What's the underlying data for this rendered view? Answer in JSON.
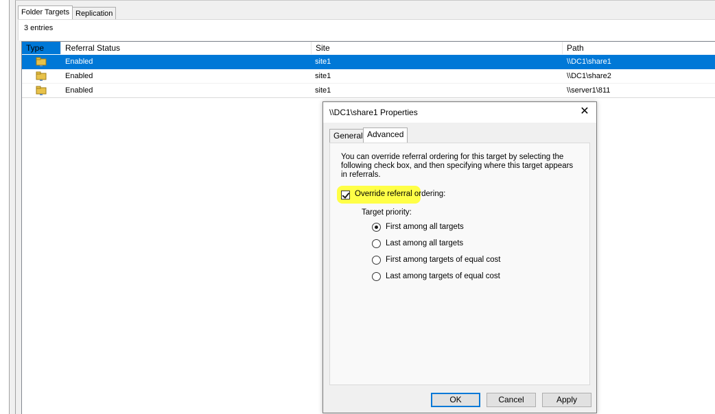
{
  "tabs": [
    {
      "label": "Folder Targets",
      "selected": true
    },
    {
      "label": "Replication",
      "selected": false
    }
  ],
  "entries_count": "3 entries",
  "columns": [
    "Type",
    "Referral Status",
    "Site",
    "Path"
  ],
  "rows": [
    {
      "icon": "shared-folder-icon",
      "status": "Enabled",
      "site": "site1",
      "path": "\\\\DC1\\share1",
      "selected": true
    },
    {
      "icon": "shared-folder-icon",
      "status": "Enabled",
      "site": "site1",
      "path": "\\\\DC1\\share2",
      "selected": false
    },
    {
      "icon": "shared-folder-icon",
      "status": "Enabled",
      "site": "site1",
      "path": "\\\\server1\\811",
      "selected": false
    }
  ],
  "dialog": {
    "title": "\\\\DC1\\share1 Properties",
    "close_glyph": "✕",
    "tabs": [
      {
        "label": "General",
        "selected": false
      },
      {
        "label": "Advanced",
        "selected": true
      }
    ],
    "description": "You can override referral ordering for this target by selecting the following check box, and then specifying where this target appears in referrals.",
    "override_checkbox": {
      "label": "Override referral ordering:",
      "checked": true
    },
    "target_priority_label": "Target priority:",
    "options": [
      {
        "label": "First among all targets",
        "selected": true
      },
      {
        "label": "Last among all targets",
        "selected": false
      },
      {
        "label": "First among targets of equal cost",
        "selected": false
      },
      {
        "label": "Last among targets of equal cost",
        "selected": false
      }
    ],
    "buttons": {
      "ok": "OK",
      "cancel": "Cancel",
      "apply": "Apply"
    }
  },
  "colors": {
    "selection": "#0078d7",
    "highlight": "#ffff33"
  }
}
